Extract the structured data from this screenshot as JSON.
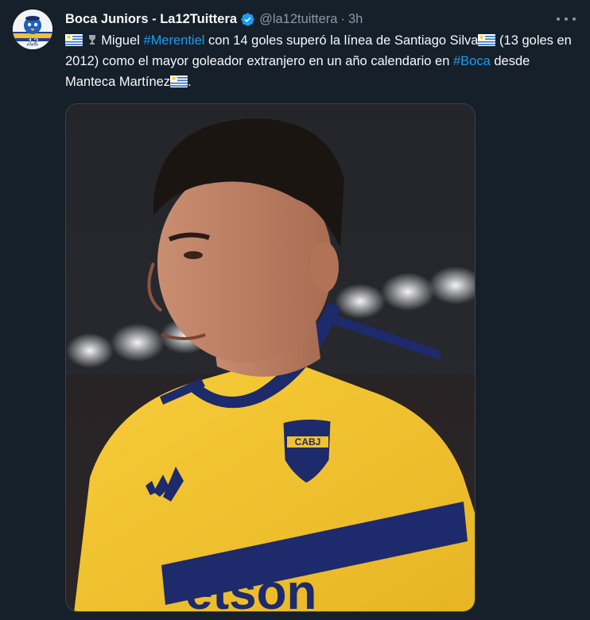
{
  "tweet": {
    "display_name": "Boca Juniors - La12Tuittera",
    "handle": "@la12tuittera",
    "separator": "·",
    "time": "3h",
    "text": {
      "part1": "Miguel",
      "tag1": "#Merentiel",
      "part2": "con 14 goles superó la línea de Santiago Silva",
      "part3": "(13 goles en 2012) como el mayor goleador extranjero en un año calendario en",
      "tag2": "#Boca",
      "part4": "desde Manteca Martínez",
      "end": "."
    },
    "avatar_text": "12",
    "media_jersey_text": "CABJ",
    "media_sponsor_text": "etson"
  },
  "colors": {
    "background": "#15202b",
    "text": "#f7f9f9",
    "secondary": "#8b98a5",
    "link": "#1d9bf0",
    "verified": "#1d9bf0",
    "jersey_yellow": "#f2c230",
    "jersey_blue": "#1d2a6b"
  },
  "icons": {
    "verified": "verified-badge-icon",
    "more": "more-options-icon",
    "flag": "uruguay-flag-icon"
  }
}
